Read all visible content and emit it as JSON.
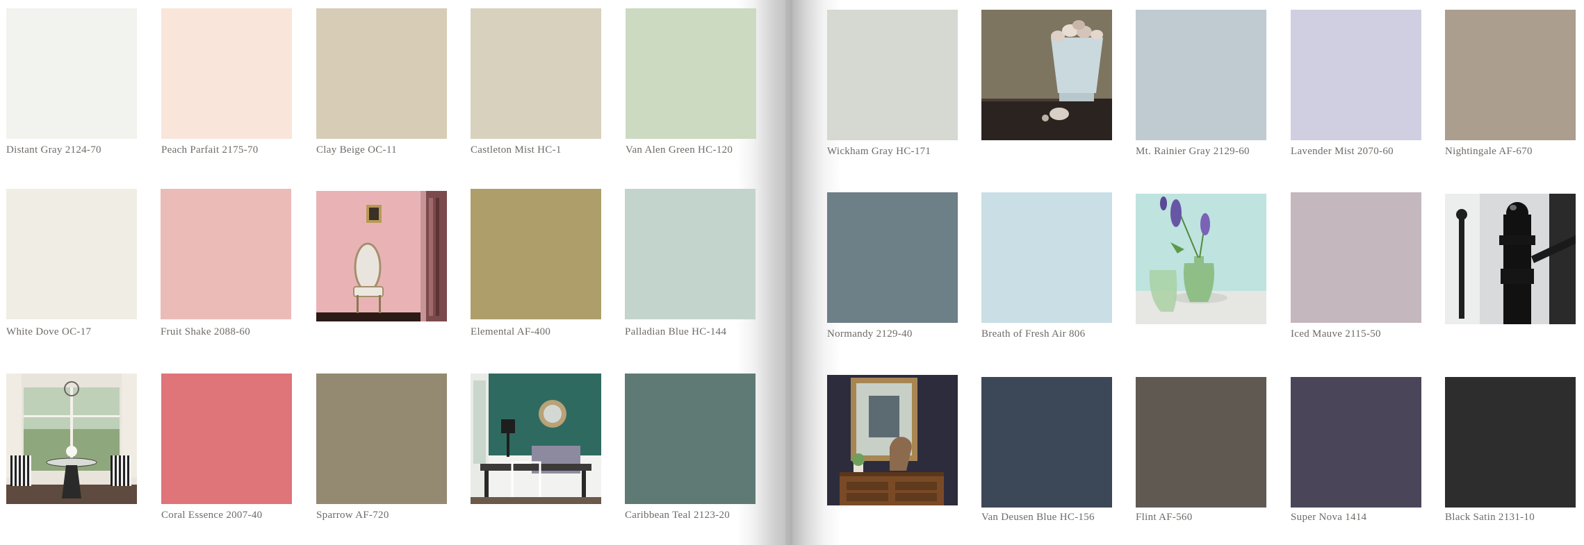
{
  "left_page": {
    "row1": [
      {
        "name": "Distant Gray 2124-70",
        "color": "#f2f2ee"
      },
      {
        "name": "Peach Parfait 2175-70",
        "color": "#f9e5da"
      },
      {
        "name": "Clay Beige OC-11",
        "color": "#d7cdb7"
      },
      {
        "name": "Castleton Mist HC-1",
        "color": "#d8d1be"
      },
      {
        "name": "Van Alen Green HC-120",
        "color": "#cbdac1"
      }
    ],
    "row2": [
      {
        "name": "White Dove OC-17",
        "color": "#f0ede4"
      },
      {
        "name": "Fruit Shake 2088-60",
        "color": "#ebbbb8"
      },
      {
        "photo": "pink-room-chair-photo"
      },
      {
        "name": "Elemental AF-400",
        "color": "#ae9f6a"
      },
      {
        "name": "Palladian Blue HC-144",
        "color": "#c3d4cd"
      }
    ],
    "row3": [
      {
        "photo": "sunroom-dining-photo"
      },
      {
        "name": "Coral Essence 2007-40",
        "color": "#df7479"
      },
      {
        "name": "Sparrow AF-720",
        "color": "#938a71"
      },
      {
        "photo": "teal-dining-room-photo"
      },
      {
        "name": "Caribbean Teal 2123-20",
        "color": "#5f7a74"
      }
    ]
  },
  "right_page": {
    "row1": [
      {
        "name": "Wickham Gray HC-171",
        "color": "#d5d9d1"
      },
      {
        "photo": "colander-shells-photo"
      },
      {
        "name": "Mt. Rainier Gray 2129-60",
        "color": "#c0cbd1"
      },
      {
        "name": "Lavender Mist 2070-60",
        "color": "#d0cfe1"
      },
      {
        "name": "Nightingale AF-670",
        "color": "#ab9e8f"
      }
    ],
    "row2": [
      {
        "name": "Normandy 2129-40",
        "color": "#6d7f87"
      },
      {
        "name": "Breath of Fresh Air 806",
        "color": "#c9dfe5"
      },
      {
        "photo": "lupine-vase-photo"
      },
      {
        "name": "Iced Mauve 2115-50",
        "color": "#c4b7bd"
      },
      {
        "photo": "black-newel-post-photo"
      }
    ],
    "row3": [
      {
        "photo": "horse-bust-dresser-photo"
      },
      {
        "name": "Van Deusen Blue HC-156",
        "color": "#3c4757"
      },
      {
        "name": "Flint AF-560",
        "color": "#5f5952"
      },
      {
        "name": "Super Nova 1414",
        "color": "#4a4559"
      },
      {
        "name": "Black Satin 2131-10",
        "color": "#2d2d2e"
      }
    ]
  }
}
